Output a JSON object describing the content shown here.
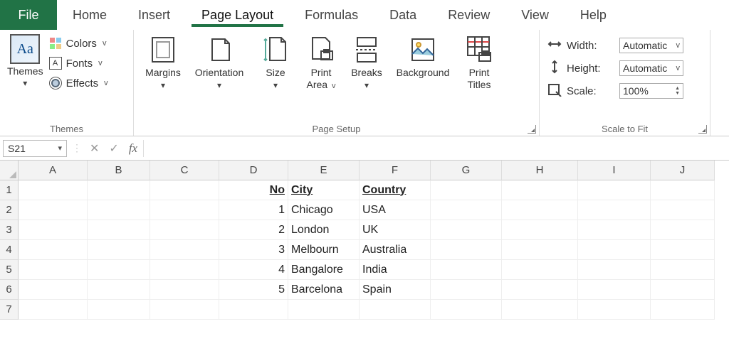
{
  "tabs": {
    "file": "File",
    "items": [
      "Home",
      "Insert",
      "Page Layout",
      "Formulas",
      "Data",
      "Review",
      "View",
      "Help"
    ],
    "active": 2
  },
  "ribbon": {
    "themes": {
      "big_label": "Themes",
      "colors": "Colors",
      "fonts": "Fonts",
      "effects": "Effects",
      "group_label": "Themes"
    },
    "page_setup": {
      "margins": "Margins",
      "orientation": "Orientation",
      "size": "Size",
      "print_area_l1": "Print",
      "print_area_l2": "Area",
      "breaks": "Breaks",
      "background": "Background",
      "print_titles_l1": "Print",
      "print_titles_l2": "Titles",
      "group_label": "Page Setup"
    },
    "scale": {
      "width_label": "Width:",
      "width_value": "Automatic",
      "height_label": "Height:",
      "height_value": "Automatic",
      "scale_label": "Scale:",
      "scale_value": "100%",
      "group_label": "Scale to Fit"
    }
  },
  "formula_bar": {
    "name_box": "S21",
    "fx": "fx",
    "value": ""
  },
  "columns": [
    "A",
    "B",
    "C",
    "D",
    "E",
    "F",
    "G",
    "H",
    "I",
    "J"
  ],
  "rows": [
    1,
    2,
    3,
    4,
    5,
    6,
    7
  ],
  "sheet": {
    "headers": {
      "no": "No",
      "city": "City",
      "country": "Country"
    },
    "data": [
      {
        "no": "1",
        "city": "Chicago",
        "country": "USA"
      },
      {
        "no": "2",
        "city": "London",
        "country": "UK"
      },
      {
        "no": "3",
        "city": "Melbourn",
        "country": "Australia"
      },
      {
        "no": "4",
        "city": "Bangalore",
        "country": "India"
      },
      {
        "no": "5",
        "city": "Barcelona",
        "country": "Spain"
      }
    ]
  }
}
